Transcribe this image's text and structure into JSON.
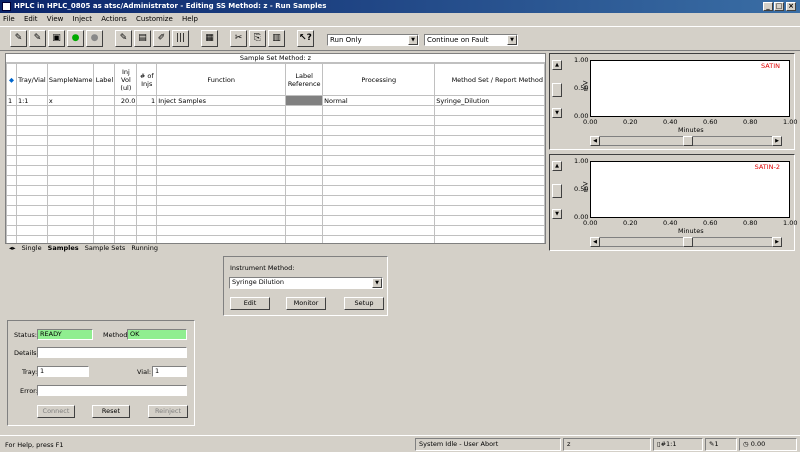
{
  "window": {
    "title": "HPLC in HPLC_0805 as atsc/Administrator - Editing SS Method: z - Run Samples"
  },
  "menu": [
    "File",
    "Edit",
    "View",
    "Inject",
    "Actions",
    "Customize",
    "Help"
  ],
  "toolbar": {
    "run_mode": "Run Only",
    "fault_mode": "Continue on Fault"
  },
  "grid": {
    "title": "Sample Set Method: z",
    "columns": [
      "Tray/Vial",
      "SampleName",
      "Label",
      "Inj Vol (ul)",
      "# of Injs",
      "Function",
      "Label Reference",
      "Processing",
      "Method Set / Report Method"
    ],
    "rows": [
      [
        "1",
        "1:1",
        "x",
        "",
        "20.0",
        "1",
        "Inject Samples",
        "",
        "Normal",
        "Syringe_Dilution"
      ]
    ],
    "tabs": [
      "Single",
      "Samples",
      "Sample Sets",
      "Running"
    ],
    "active_tab": "Samples"
  },
  "plots": [
    {
      "label": "SATIN",
      "ylabel": "mV",
      "xlabel": "Minutes",
      "yticks": [
        "1.00",
        "0.50",
        "0.00"
      ],
      "xticks": [
        "0.00",
        "0.20",
        "0.40",
        "0.60",
        "0.80",
        "1.00"
      ]
    },
    {
      "label": "SATIN-2",
      "ylabel": "mV",
      "xlabel": "Minutes",
      "yticks": [
        "1.00",
        "0.50",
        "0.00"
      ],
      "xticks": [
        "0.00",
        "0.20",
        "0.40",
        "0.60",
        "0.80",
        "1.00"
      ]
    }
  ],
  "instrument": {
    "label": "Instrument Method:",
    "value": "Syringe Dilution",
    "edit": "Edit",
    "monitor": "Monitor",
    "setup": "Setup"
  },
  "status": {
    "status_label": "Status:",
    "status_value": "READY",
    "method_label": "Method:",
    "method_value": "OK",
    "details_label": "Details:",
    "tray_label": "Tray:",
    "tray_value": "1",
    "vial_label": "Vial:",
    "vial_value": "1",
    "error_label": "Error:",
    "connect": "Connect",
    "reset": "Reset",
    "reinject": "Reinject"
  },
  "statusbar": {
    "help": "For Help, press F1",
    "state": "System Idle - User Abort",
    "method": "z",
    "vial": "1:1",
    "inj": "1",
    "time": "0.00"
  },
  "colors": {
    "ok_green": "#90ee90",
    "signal_red": "#e00000",
    "title_blue": "#0a246a"
  }
}
